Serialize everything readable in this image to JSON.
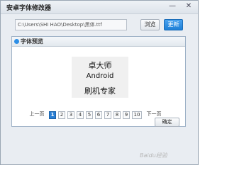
{
  "window": {
    "title": "安卓字体修改器",
    "min_glyph": "—",
    "close_glyph": "✕"
  },
  "path_bar": {
    "value": "C:\\Users\\SHI HAO\\Desktop\\黑体.ttf",
    "browse_label": "浏览",
    "update_label": "更新"
  },
  "preview": {
    "title": "字体预览",
    "sample_lines": [
      "卓大师",
      "Android",
      "刷机专家"
    ],
    "confirm_label": "确定"
  },
  "pager": {
    "prev_label": "上一页",
    "pages": [
      "1",
      "2",
      "3",
      "4",
      "5",
      "6",
      "7",
      "8",
      "9",
      "10"
    ],
    "active_page": "1",
    "next_label": "下一页"
  },
  "watermark": "Baidu经验",
  "colors": {
    "accent": "#1e7fd6",
    "active_page": "#2a7fd4"
  }
}
